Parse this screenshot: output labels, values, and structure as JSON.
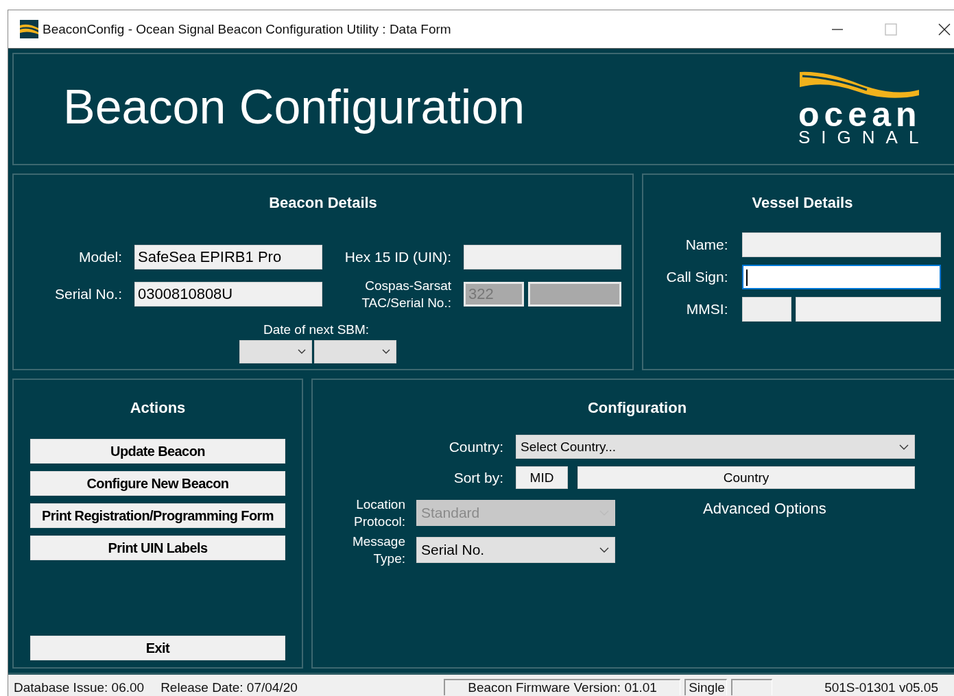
{
  "window": {
    "title": "BeaconConfig - Ocean Signal Beacon Configuration Utility : Data Form"
  },
  "header": {
    "title": "Beacon Configuration",
    "logo_word": "ocean",
    "logo_subword": "SIGNAL"
  },
  "beacon_details": {
    "title": "Beacon Details",
    "fields": [
      {
        "label": "Model:",
        "value": "SafeSea EPIRB1 Pro"
      },
      {
        "label": "Serial No.:",
        "value": "0300810808U"
      }
    ],
    "hex_id": {
      "label": "Hex 15 ID (UIN):"
    },
    "tac": {
      "label": "Cospas-Sarsat TAC/Serial No.:",
      "value": "322",
      "disabled": true
    },
    "sbm": {
      "label": "Date of next SBM:"
    }
  },
  "vessel_details": {
    "title": "Vessel Details",
    "fields": [
      {
        "label": "Name:",
        "kind": "single"
      },
      {
        "label": "Call Sign:",
        "kind": "focused"
      },
      {
        "label": "MMSI:",
        "kind": "split"
      }
    ]
  },
  "actions": {
    "title": "Actions",
    "buttons": [
      "Update Beacon",
      "Configure New Beacon",
      "Print Registration/Programming Form",
      "Print UIN Labels"
    ],
    "exit": "Exit"
  },
  "configuration": {
    "title": "Configuration",
    "country": {
      "label": "Country:",
      "placeholder": "Select Country..."
    },
    "sort_by": {
      "label": "Sort by:",
      "buttons": [
        "MID",
        "Country"
      ]
    },
    "location_protocol": {
      "label": "Location Protocol:",
      "value": "Standard",
      "disabled": true
    },
    "message_type": {
      "label": "Message Type:",
      "value": "Serial No.",
      "disabled": false
    },
    "advanced_options": "Advanced Options"
  },
  "status_bar": {
    "database_issue": "Database Issue: 06.00",
    "release_date": "Release Date: 07/04/20",
    "firmware": "Beacon Firmware Version:  01.01",
    "mode": "Single",
    "version": "501S-01301  v05.05"
  }
}
